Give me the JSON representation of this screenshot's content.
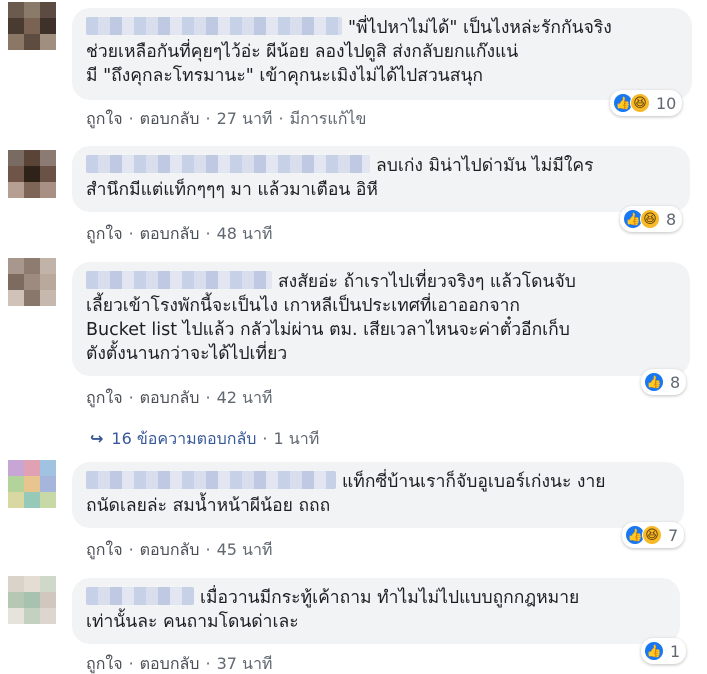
{
  "comments": [
    {
      "text": "\"พี่ไปหาไม่ได้\" เป็นไงหล่ะรักกันจริง\nช่วยเหลือกันที่คุยๆไว้อ่ะ ผีน้อย ลองไปดูสิ ส่งกลับยกแก๊งแน่\nมี \"ถึงคุกละโทรมานะ\" เข้าคุกนะเมิงไม่ได้ไปสวนสนุก",
      "reaction_count": "10",
      "like_label": "ถูกใจ",
      "reply_label": "ตอบกลับ",
      "time": "27 นาที",
      "edited": "มีการแก้ไข"
    },
    {
      "text": "ลบเก่ง มิน่าไปด่ามัน ไม่มีใคร\nสำนึกมีแต่แท็กๆๆๆ มา แล้วมาเตือน อิหี",
      "reaction_count": "8",
      "like_label": "ถูกใจ",
      "reply_label": "ตอบกลับ",
      "time": "48 นาที"
    },
    {
      "text": "สงสัยอ่ะ ถ้าเราไปเที่ยวจริงๆ แล้วโดนจับ\nเลี้ยวเข้าโรงพักนี้จะเป็นไง เกาหลีเป็นประเทศที่เอาออกจาก\nBucket list ไปแล้ว กลัวไม่ผ่าน ตม. เสียเวลาไหนจะค่าตั๋วอีกเก็บ\nตังตั้งนานกว่าจะได้ไปเที่ยว",
      "reaction_count": "8",
      "like_label": "ถูกใจ",
      "reply_label": "ตอบกลับ",
      "time": "42 นาที"
    },
    {
      "text": "แท็กซี่บ้านเราก็จับอูเบอร์เก่งนะ งาย\nถนัดเลยล่ะ สมน้ำหน้าผีน้อย ถถถ",
      "reaction_count": "7",
      "like_label": "ถูกใจ",
      "reply_label": "ตอบกลับ",
      "time": "45 นาที"
    },
    {
      "text": "เมื่อวานมีกระทู้เค้าถาม ทำไมไม่ไปแบบถูกกฎหมาย\nเท่านั้นละ คนถามโดนด่าเละ",
      "reaction_count": "1",
      "like_label": "ถูกใจ",
      "reply_label": "ตอบกลับ",
      "time": "37 นาที"
    }
  ],
  "replies_link": {
    "label": "16 ข้อความตอบกลับ",
    "time": "1 นาที"
  },
  "icons": {
    "like": "thumbs-up-icon",
    "haha": "laughing-face-icon",
    "reply": "reply-arrow-icon"
  },
  "colors": {
    "like_blue": "#1877f2",
    "haha_yellow": "#f7b928",
    "link_blue": "#385898",
    "bubble_bg": "#f2f3f5"
  }
}
